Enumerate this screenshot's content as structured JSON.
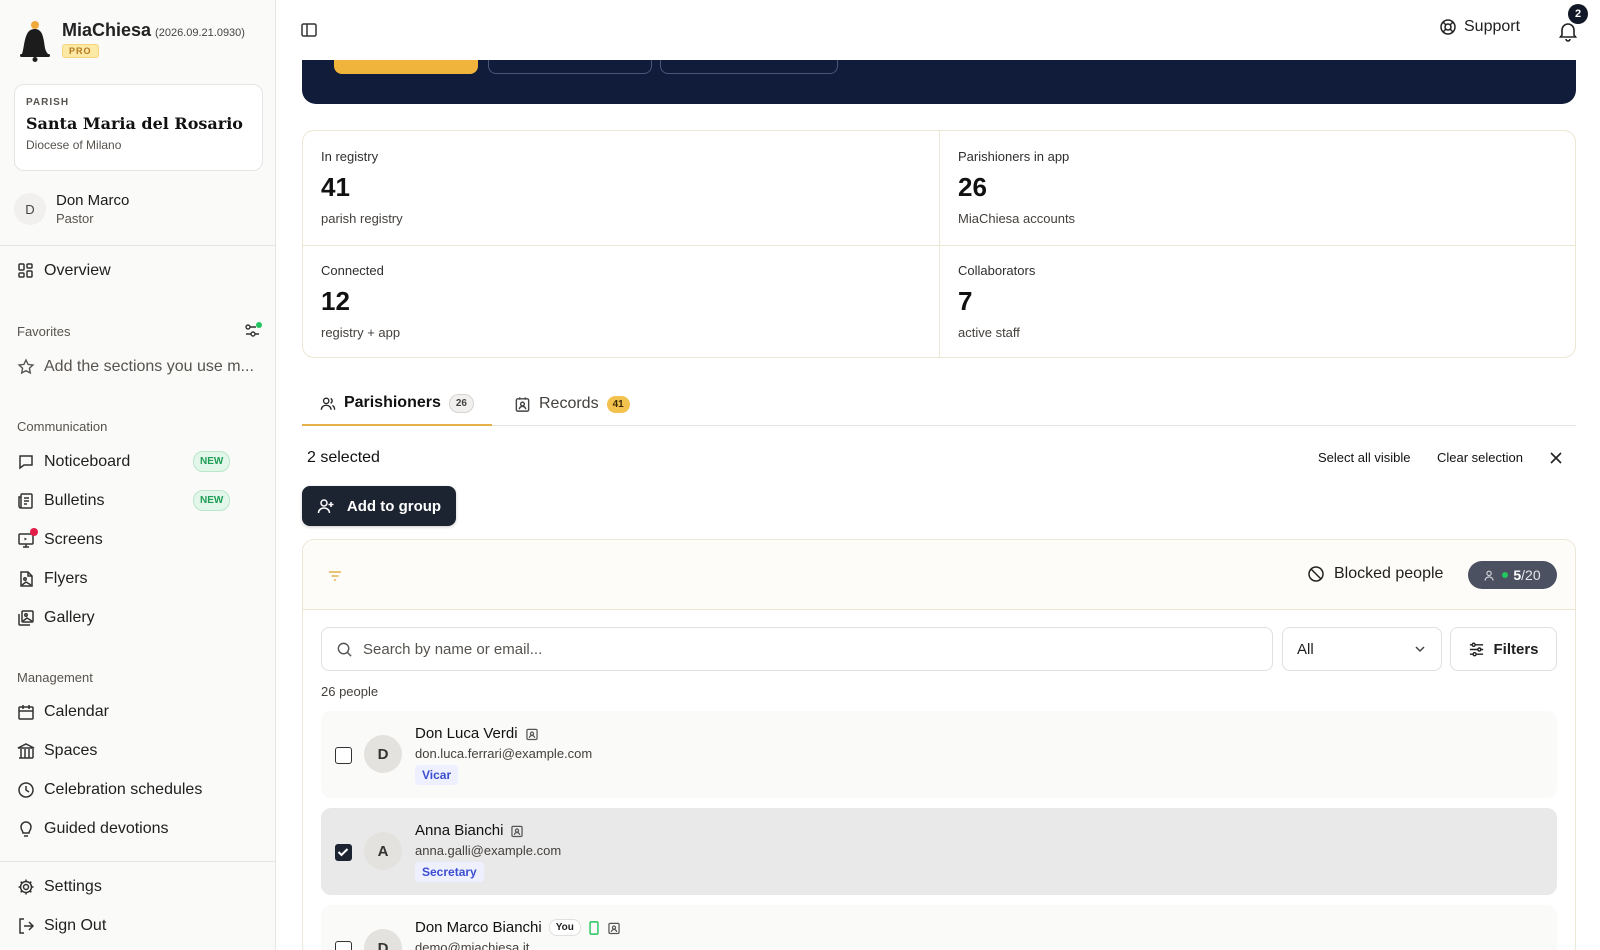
{
  "brand": {
    "name": "MiaChiesa",
    "version": "(2026.09.21.0930)",
    "plan": "PRO"
  },
  "parish": {
    "label": "PARISH",
    "name": "Santa Maria del Rosario",
    "diocese": "Diocese of Milano"
  },
  "user": {
    "initial": "D",
    "name": "Don Marco",
    "role": "Pastor"
  },
  "nav": {
    "overview": "Overview",
    "favorites_label": "Favorites",
    "favorites_placeholder": "Add the sections you use m...",
    "communication_label": "Communication",
    "noticeboard": "Noticeboard",
    "bulletins": "Bulletins",
    "screens": "Screens",
    "flyers": "Flyers",
    "gallery": "Gallery",
    "new_badge": "NEW",
    "management_label": "Management",
    "calendar": "Calendar",
    "spaces": "Spaces",
    "celebration_schedules": "Celebration schedules",
    "guided_devotions": "Guided devotions",
    "settings": "Settings",
    "sign_out": "Sign Out"
  },
  "topbar": {
    "support": "Support",
    "notification_count": "2"
  },
  "stats": [
    {
      "label": "In registry",
      "value": "41",
      "sub": "parish registry"
    },
    {
      "label": "Parishioners in app",
      "value": "26",
      "sub": "MiaChiesa accounts"
    },
    {
      "label": "Connected",
      "value": "12",
      "sub": "registry + app"
    },
    {
      "label": "Collaborators",
      "value": "7",
      "sub": "active staff"
    }
  ],
  "tabs": [
    {
      "label": "Parishioners",
      "count": "26"
    },
    {
      "label": "Records",
      "count": "41"
    }
  ],
  "selection": {
    "count_text": "2 selected",
    "select_all": "Select all visible",
    "clear": "Clear selection",
    "add_to_group": "Add to group"
  },
  "panel": {
    "blocked": "Blocked people",
    "quota_used": "5",
    "quota_total": "/20",
    "search_placeholder": "Search by name or email...",
    "select_value": "All",
    "filters": "Filters",
    "people_count": "26 people"
  },
  "people": [
    {
      "initial": "D",
      "name": "Don Luca Verdi",
      "email": "don.luca.ferrari@example.com",
      "role": "Vicar",
      "checked": false
    },
    {
      "initial": "A",
      "name": "Anna Bianchi",
      "email": "anna.galli@example.com",
      "role": "Secretary",
      "checked": true
    },
    {
      "initial": "D",
      "name": "Don Marco Bianchi",
      "email": "demo@miachiesa.it",
      "you": "You",
      "checked": false
    }
  ],
  "colors": {
    "accent": "#e5b04a",
    "navy": "#101c3a",
    "dark_button": "#1c2331",
    "new_green": "#1f9d55",
    "role_blue": "#3b4ecf"
  }
}
